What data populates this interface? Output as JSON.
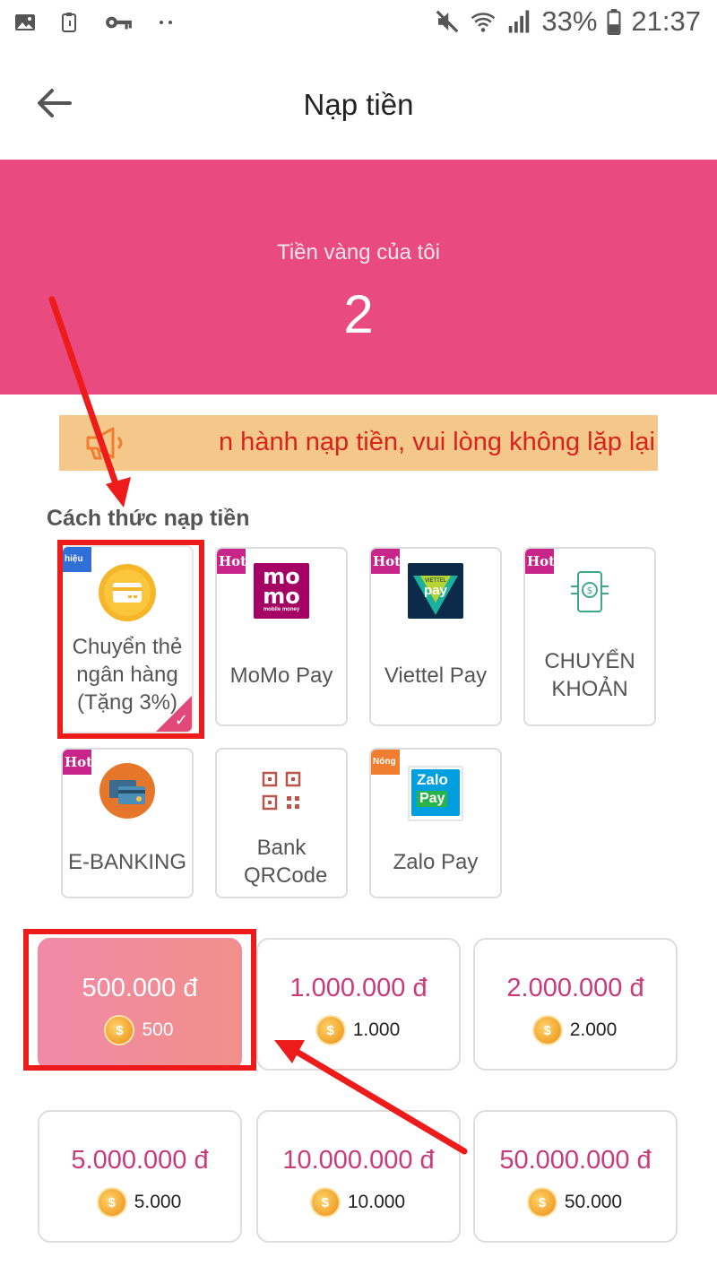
{
  "status_bar": {
    "battery": "33%",
    "time": "21:37",
    "left_icons": [
      "image-icon",
      "clipboard-icon",
      "key-icon",
      "more-dots-icon"
    ],
    "right_icons": [
      "mute-icon",
      "wifi-icon",
      "signal-icon",
      "battery-icon"
    ]
  },
  "header": {
    "title": "Nạp tiền",
    "back_icon": "arrow-left-icon"
  },
  "balance": {
    "label": "Tiền vàng của tôi",
    "value": "2",
    "background": "#e94a80"
  },
  "notice": {
    "icon": "megaphone-icon",
    "text": "n hành nạp tiền, vui lòng không lặp lại nh",
    "color": "#d8221d",
    "background": "#f4c88a"
  },
  "methods_section": {
    "title": "Cách thức nạp tiền",
    "items": [
      {
        "label": "Chuyển thẻ ngân hàng (Tặng 3%)",
        "tag": "hiệu",
        "icon": "bank-card-icon",
        "selected": true
      },
      {
        "label": "MoMo Pay",
        "tag": "Hot",
        "icon": "momo-logo",
        "selected": false
      },
      {
        "label": "Viettel Pay",
        "tag": "Hot",
        "icon": "viettelpay-logo",
        "selected": false
      },
      {
        "label": "CHUYỂN KHOẢN",
        "tag": "Hot",
        "icon": "phone-transfer-icon",
        "selected": false
      },
      {
        "label": "E-BANKING",
        "tag": "Hot",
        "icon": "ebanking-cards-icon",
        "selected": false
      },
      {
        "label": "Bank QRCode",
        "tag": "",
        "icon": "qrcode-icon",
        "selected": false
      },
      {
        "label": "Zalo Pay",
        "tag": "Nóng",
        "icon": "zalopay-logo",
        "selected": false
      }
    ],
    "logo_text": {
      "momo_top": "mo",
      "momo_bottom": "mo",
      "momo_sub": "mobile money",
      "viettel_small": "VIETTEL",
      "viettel_pay": "pay",
      "zalo": "Zalo",
      "zalo_pay": "Pay"
    }
  },
  "amounts": [
    {
      "price": "500.000 đ",
      "coins": "500",
      "selected": true
    },
    {
      "price": "1.000.000 đ",
      "coins": "1.000",
      "selected": false
    },
    {
      "price": "2.000.000 đ",
      "coins": "2.000",
      "selected": false
    },
    {
      "price": "5.000.000 đ",
      "coins": "5.000",
      "selected": false
    },
    {
      "price": "10.000.000 đ",
      "coins": "10.000",
      "selected": false
    },
    {
      "price": "50.000.000 đ",
      "coins": "50.000",
      "selected": false
    }
  ],
  "coin_symbol": "$",
  "annotation_color": "#ee1b1b"
}
